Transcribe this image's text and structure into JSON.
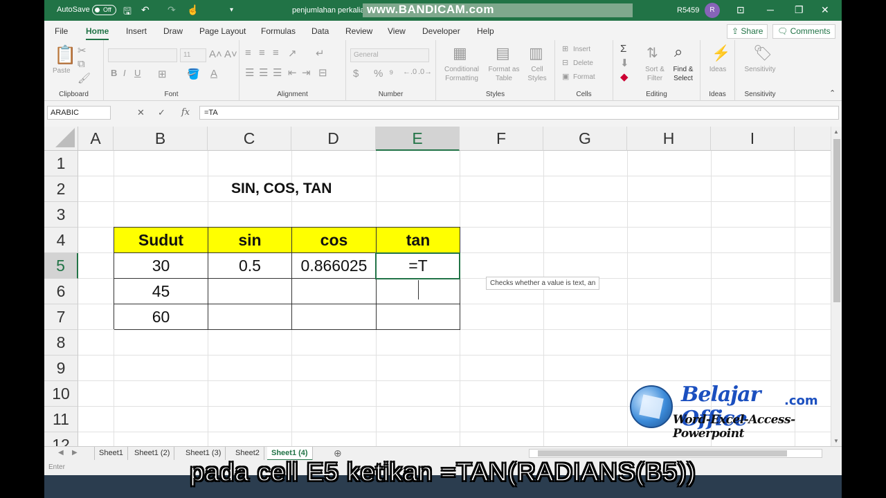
{
  "titlebar": {
    "autosave_label": "AutoSave",
    "autosave_state": "Off",
    "document_name": "penjumlahan perkalian",
    "watermark": "www.BANDICAM.com",
    "user_id": "R5459",
    "avatar_initial": "R"
  },
  "menu": {
    "tabs": [
      "File",
      "Home",
      "Insert",
      "Draw",
      "Page Layout",
      "Formulas",
      "Data",
      "Review",
      "View",
      "Developer",
      "Help"
    ],
    "active_tab": "Home",
    "share_label": "Share",
    "comments_label": "Comments"
  },
  "ribbon": {
    "groups": {
      "clipboard": "Clipboard",
      "font": "Font",
      "alignment": "Alignment",
      "number": "Number",
      "styles": "Styles",
      "cells": "Cells",
      "editing": "Editing",
      "ideas": "Ideas",
      "sensitivity": "Sensitivity"
    },
    "paste_label": "Paste",
    "font_size": "11",
    "number_format": "General",
    "conditional_formatting": "Conditional Formatting",
    "format_as_table": "Format as Table",
    "cell_styles": "Cell Styles",
    "insert": "Insert",
    "delete": "Delete",
    "format": "Format",
    "sort_filter": "Sort & Filter",
    "find_select": "Find & Select",
    "ideas_btn": "Ideas",
    "sensitivity_btn": "Sensitivity"
  },
  "formula_bar": {
    "name_box": "ARABIC",
    "formula": "=TA"
  },
  "columns": [
    "A",
    "B",
    "C",
    "D",
    "E",
    "F",
    "G",
    "H",
    "I"
  ],
  "rows": [
    "1",
    "2",
    "3",
    "4",
    "5",
    "6",
    "7",
    "8",
    "9",
    "10",
    "11",
    "12"
  ],
  "sheet": {
    "title": "SIN, COS, TAN",
    "headers": [
      "Sudut",
      "sin",
      "cos",
      "tan"
    ],
    "data": [
      [
        "30",
        "0.5",
        "0.866025",
        "=T"
      ],
      [
        "45",
        "",
        "",
        ""
      ],
      [
        "60",
        "",
        "",
        ""
      ]
    ]
  },
  "tooltip": "Checks whether a value is text, an",
  "sheet_tabs": [
    "Sheet1",
    "Sheet1 (2)",
    "Sheet1 (3)",
    "Sheet2",
    "Sheet1 (4)"
  ],
  "active_sheet": "Sheet1 (4)",
  "status": "Enter",
  "logo": {
    "brand": "Belajar Office",
    "domain": ".com",
    "tagline": "Word-Excel-Access-Powerpoint"
  },
  "caption": "pada cell E5 ketikan =TAN(RADIANS(B5))",
  "colors": {
    "excel_green": "#217346",
    "header_fill": "#ffff00"
  }
}
